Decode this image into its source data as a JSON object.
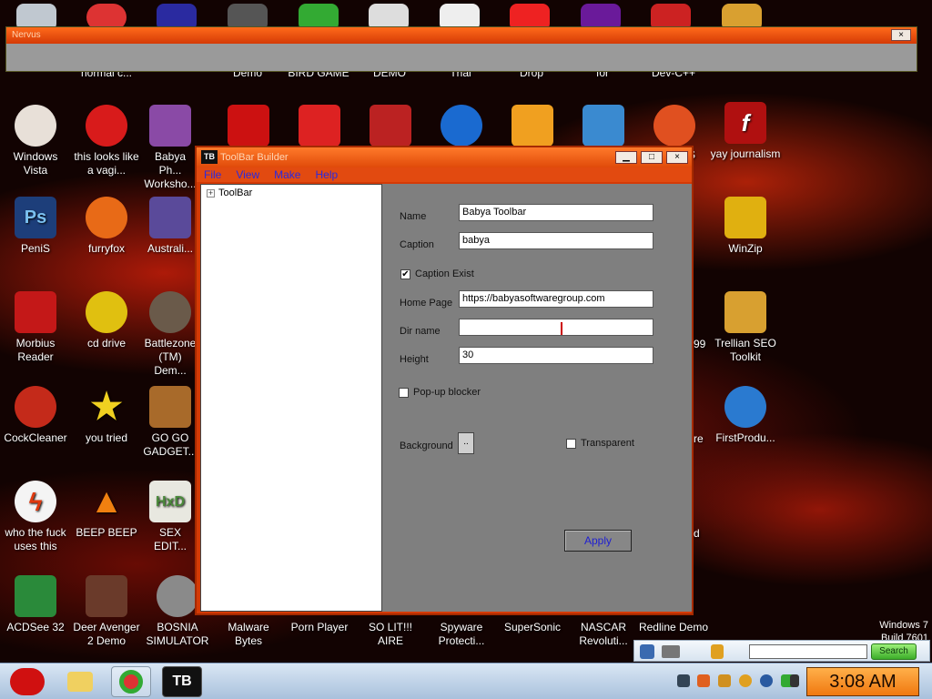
{
  "top_row_labels": [
    "normal c...",
    "Demo",
    "BIRD GAME",
    "DEMO",
    "Thai",
    "Drop",
    "for",
    "Dev-C++"
  ],
  "desktop_icons": [
    {
      "label": "Windows Vista",
      "icon": "egg-icon",
      "color": "#e8e0d8"
    },
    {
      "label": "this looks like a vagi...",
      "icon": "opera-icon",
      "color": "#d81b1b"
    },
    {
      "label": "Babya Ph... Worksho...",
      "icon": "photo-icon",
      "color": "#8a4aa6"
    },
    {
      "label": "PeniS",
      "icon": "photoshop-icon",
      "color": "#1d3e7a"
    },
    {
      "label": "furryfox",
      "icon": "firefox-icon",
      "color": "#e86a17"
    },
    {
      "label": "Australi...",
      "icon": "globe-icon",
      "color": "#5a4a9a"
    },
    {
      "label": "Morbius Reader",
      "icon": "pdf-icon",
      "color": "#c41818"
    },
    {
      "label": "cd drive",
      "icon": "cd-icon",
      "color": "#e0c010"
    },
    {
      "label": "Battlezone (TM) Dem...",
      "icon": "battlezone-icon",
      "color": "#6a5a4a"
    },
    {
      "label": "CockCleaner",
      "icon": "ccleaner-icon",
      "color": "#c42a1a"
    },
    {
      "label": "you tried",
      "icon": "star-icon",
      "color": "#f0d020"
    },
    {
      "label": "GO GO GADGET...",
      "icon": "briefcase-icon",
      "color": "#a86a2a"
    },
    {
      "label": "who the fuck uses this",
      "icon": "lightning-icon",
      "color": "#e03a10"
    },
    {
      "label": "BEEP BEEP",
      "icon": "vlc-icon",
      "color": "#f08010"
    },
    {
      "label": "SEX EDIT...",
      "icon": "hxd-icon",
      "color": "#4a8a3a"
    },
    {
      "label": "ACDSee 32",
      "icon": "eye-icon",
      "color": "#2a8a3a"
    },
    {
      "label": "Deer Avenger 2 Demo",
      "icon": "hunter-icon",
      "color": "#6a3a2a"
    },
    {
      "label": "BOSNIA SIMULATOR",
      "icon": "mine-icon",
      "color": "#8a8a8a"
    }
  ],
  "right_icons": [
    {
      "label": "yay journalism",
      "icon": "flash-icon",
      "color": "#b01010"
    },
    {
      "label": "WinZip",
      "icon": "winzip-icon",
      "color": "#e0b010"
    },
    {
      "label": "Trellian SEO Toolkit",
      "icon": "folder-icon",
      "color": "#d8a030"
    },
    {
      "label": "FirstProdu...",
      "icon": "chrome-icon",
      "color": "#2a7ad0"
    }
  ],
  "bottom_row_labels": [
    "Malware Bytes",
    "Porn Player",
    "SO LIT!!! AIRE",
    "Spyware Protecti...",
    "SuperSonic",
    "NASCAR Revoluti...",
    "Redline Demo"
  ],
  "partial_labels": {
    "s": "S",
    "nine": "99",
    "re": "re",
    "d": "d"
  },
  "orange_window": {
    "title": "Nervus",
    "close": "×"
  },
  "window": {
    "logo": "TB",
    "title": "ToolBar Builder",
    "minimize": "▁",
    "maximize": "□",
    "close": "×",
    "menu": [
      "File",
      "View",
      "Make",
      "Help"
    ],
    "tree_root": "ToolBar",
    "tree_expander": "+",
    "fields": {
      "name_label": "Name",
      "name_value": "Babya Toolbar",
      "caption_label": "Caption",
      "caption_value": "babya",
      "caption_exist_label": "Caption Exist",
      "caption_exist_mark": "✔",
      "home_label": "Home Page",
      "home_value": "https://babyasoftwaregroup.com",
      "dir_label": "Dir name",
      "dir_value": "",
      "height_label": "Height",
      "height_value": "30",
      "popup_label": "Pop-up blocker",
      "background_label": "Background",
      "background_btn": "..",
      "transparent_label": "Transparent"
    },
    "apply_label": "Apply"
  },
  "searchbar": {
    "search_label": "Search"
  },
  "os_label": {
    "line1": "Windows 7",
    "line2": "Build 7601"
  },
  "taskbar": {
    "clock": "3:08 AM",
    "tb_label": "TB"
  }
}
